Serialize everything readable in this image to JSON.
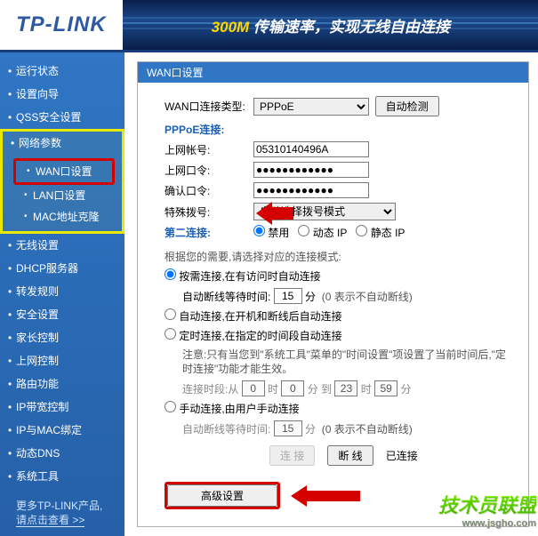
{
  "header": {
    "logo": "TP-LINK",
    "banner_highlight": "300M",
    "banner_text": " 传输速率，实现无线自由连接"
  },
  "sidebar": {
    "items": [
      "运行状态",
      "设置向导",
      "QSS安全设置",
      "网络参数",
      "无线设置",
      "DHCP服务器",
      "转发规则",
      "安全设置",
      "家长控制",
      "上网控制",
      "路由功能",
      "IP带宽控制",
      "IP与MAC绑定",
      "动态DNS",
      "系统工具"
    ],
    "submenu": [
      "WAN口设置",
      "LAN口设置",
      "MAC地址克隆"
    ],
    "footer_line1": "更多TP-LINK产品,",
    "footer_line2": "请点击查看 >>"
  },
  "panel": {
    "title": "WAN口设置",
    "wan_type_label": "WAN口连接类型:",
    "wan_type_value": "PPPoE",
    "auto_detect": "自动检测",
    "pppoe_section": "PPPoE连接:",
    "username_label": "上网帐号:",
    "username_value": "05310140496A",
    "password_label": "上网口令:",
    "password_value": "●●●●●●●●●●●●",
    "confirm_label": "确认口令:",
    "confirm_value": "●●●●●●●●●●●●",
    "special_label": "特殊拨号:",
    "special_value": "自动选择拨号模式",
    "second_conn_label": "第二连接:",
    "second_conn_options": [
      "禁用",
      "动态 IP",
      "静态 IP"
    ],
    "mode_hint": "根据您的需要,请选择对应的连接模式:",
    "mode_demand": "按需连接,在有访问时自动连接",
    "idle_label": "自动断线等待时间:",
    "idle_value": "15",
    "idle_unit": "分",
    "idle_hint": "(0 表示不自动断线)",
    "mode_auto": "自动连接,在开机和断线后自动连接",
    "mode_time": "定时连接,在指定的时间段自动连接",
    "time_note": "注意:只有当您到\"系统工具\"菜单的\"时间设置\"项设置了当前时间后,\"定时连接\"功能才能生效。",
    "time_from": "连接时段:从",
    "time_h1": "0",
    "time_m1": "0",
    "time_to": "到",
    "time_h2": "23",
    "time_m2": "59",
    "time_h": "时",
    "time_min": "分",
    "mode_manual": "手动连接,由用户手动连接",
    "idle2_value": "15",
    "btn_connect": "连 接",
    "btn_disconnect": "断 线",
    "status": "已连接",
    "btn_advanced": "高级设置"
  },
  "watermark": {
    "text": "技术员联盟",
    "url": "www.jsgho.com"
  }
}
